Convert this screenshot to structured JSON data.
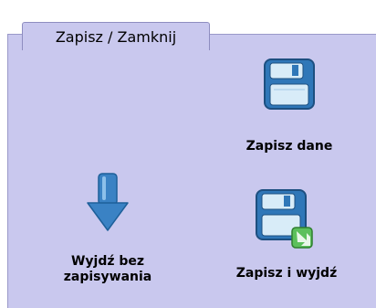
{
  "group": {
    "title": "Zapisz / Zamknij"
  },
  "actions": {
    "save": {
      "label": "Zapisz  dane",
      "icon": "floppy-disk-icon"
    },
    "exit_no_save": {
      "label_line1": "Wyjdź bez",
      "label_line2": "zapisywania",
      "icon": "arrow-down-icon"
    },
    "save_exit": {
      "label": "Zapisz i wyjdź",
      "icon": "floppy-disk-arrow-icon"
    }
  },
  "colors": {
    "panel_bg": "#c9c8ee",
    "icon_blue": "#3a82c4",
    "icon_light": "#d8ecf8",
    "arrow_green": "#3aa53a"
  }
}
